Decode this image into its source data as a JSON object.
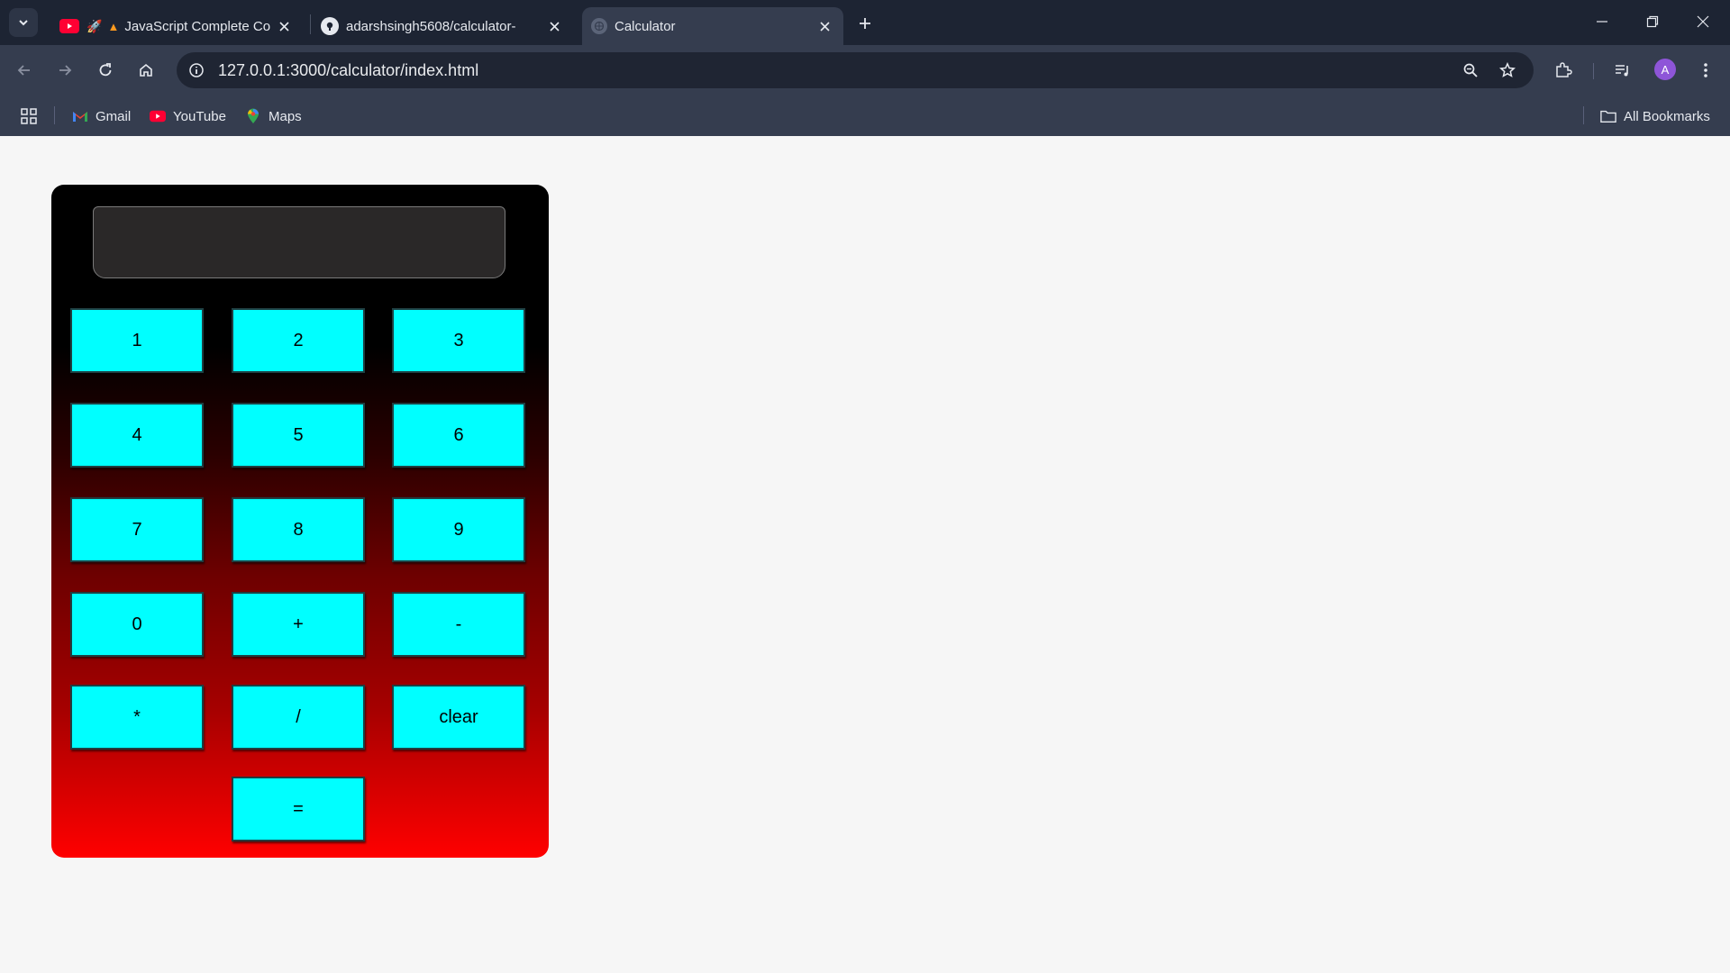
{
  "tabs": [
    {
      "title": "JavaScript Complete Co",
      "active": false
    },
    {
      "title": "adarshsingh5608/calculator-",
      "active": false
    },
    {
      "title": "Calculator",
      "active": true
    }
  ],
  "address_bar": {
    "url": "127.0.0.1:3000/calculator/index.html"
  },
  "profile": {
    "initial": "A"
  },
  "bookmarks": {
    "items": [
      {
        "label": "Gmail"
      },
      {
        "label": "YouTube"
      },
      {
        "label": "Maps"
      }
    ],
    "all_label": "All Bookmarks"
  },
  "calculator": {
    "display_value": "",
    "keys": [
      "1",
      "2",
      "3",
      "4",
      "5",
      "6",
      "7",
      "8",
      "9",
      "0",
      "+",
      "-",
      "*",
      "/",
      "clear",
      "="
    ]
  },
  "colors": {
    "key_bg": "#00ffff",
    "calc_top": "#000000",
    "calc_bottom": "#ff0000",
    "display_bg": "#2a2828",
    "page_bg": "#f6f6f6"
  },
  "icons": [
    "tab-search-icon",
    "youtube-icon",
    "rocket-icon",
    "fire-icon",
    "github-icon",
    "globe-icon",
    "close-icon",
    "plus-icon",
    "minimize-icon",
    "restore-icon",
    "back-icon",
    "forward-icon",
    "reload-icon",
    "home-icon",
    "info-icon",
    "zoom-icon",
    "star-icon",
    "extensions-icon",
    "media-icon",
    "menu-icon",
    "apps-icon",
    "gmail-icon",
    "maps-icon",
    "folder-icon"
  ]
}
